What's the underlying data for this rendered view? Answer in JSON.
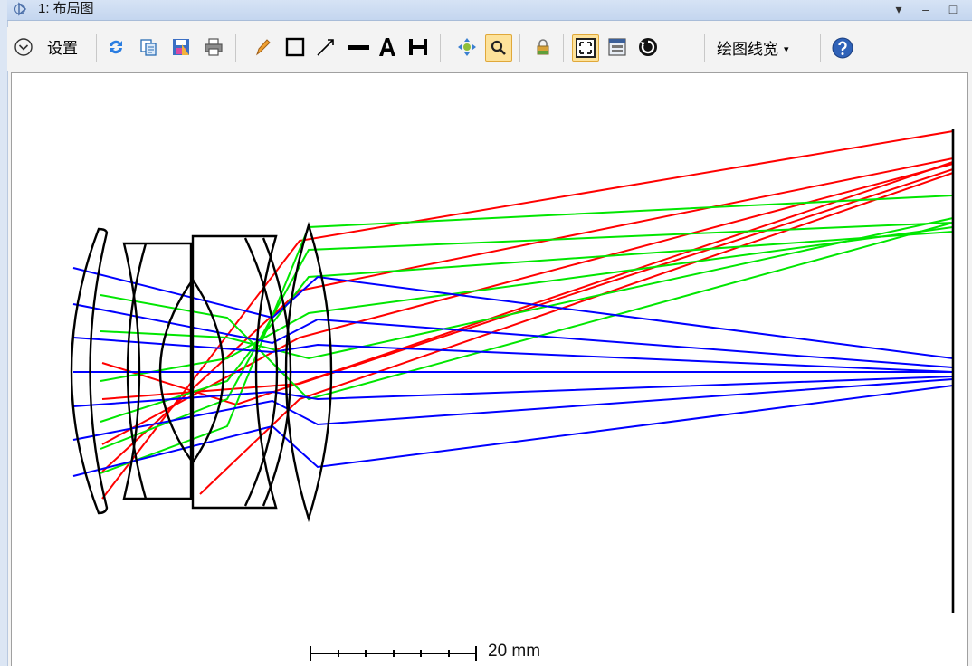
{
  "window": {
    "title": "1: 布局图",
    "controls": {
      "dropdown": "▾",
      "minimize": "–",
      "maximize": "□"
    }
  },
  "toolbar": {
    "settings_label": "设置",
    "line_width_label": "绘图线宽",
    "line_width_arrow": "▾",
    "tools": [
      "settings-chevron-icon",
      "refresh-icon",
      "copy-icon",
      "save-icon",
      "print-icon",
      "pencil-icon",
      "rectangle-icon",
      "arrow-line-icon",
      "line-icon",
      "text-icon",
      "dimension-icon",
      "pan-icon",
      "zoom-icon",
      "lock-icon",
      "fit-icon",
      "window-icon",
      "rotate-icon",
      "help-icon"
    ],
    "active_tools": [
      "zoom-icon",
      "fit-icon"
    ]
  },
  "plot": {
    "scale_bar_label": "20 mm",
    "colors": {
      "ray_red": "#ff0000",
      "ray_green": "#00e600",
      "ray_blue": "#0000ff",
      "lens": "#000000"
    }
  }
}
